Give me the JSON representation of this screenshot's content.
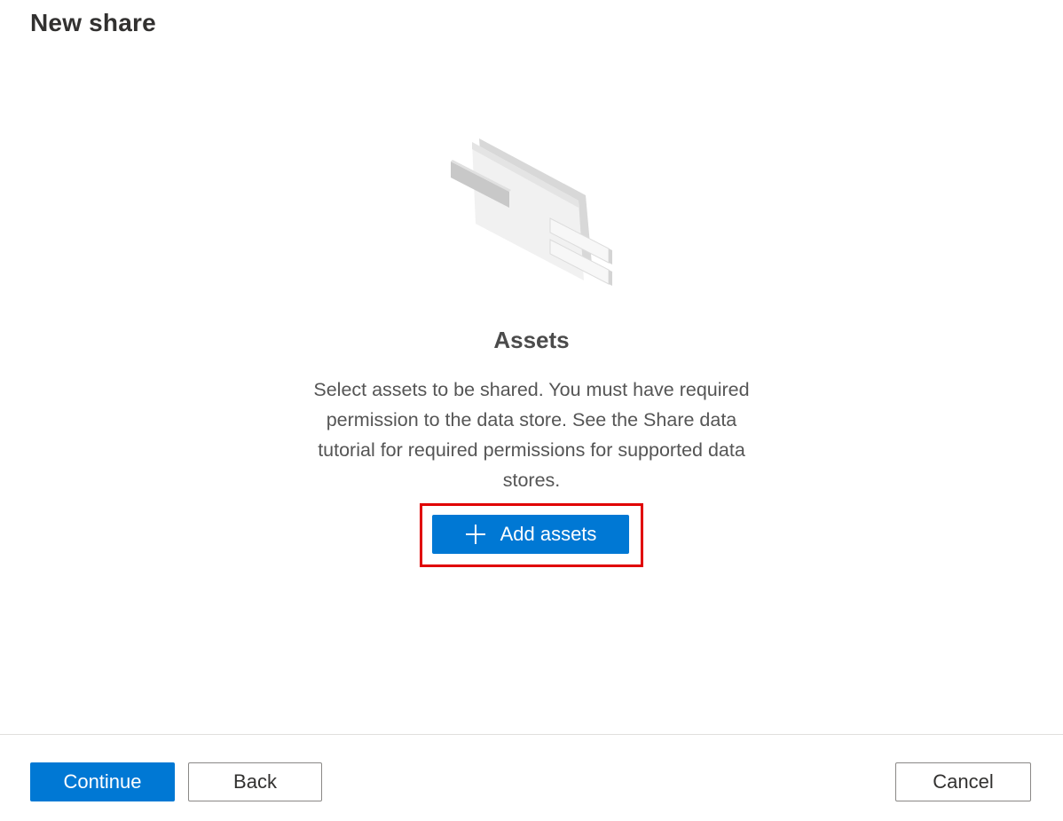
{
  "header": {
    "title": "New share"
  },
  "assets_panel": {
    "illustration_icon": "document-stack-illustration",
    "title": "Assets",
    "description": "Select assets to be shared. You must have required permission to the data store. See the Share data tutorial for required permissions for supported data stores.",
    "add_button_label": "Add assets",
    "add_button_icon": "plus-icon",
    "highlight_color": "#e00000"
  },
  "footer": {
    "continue_label": "Continue",
    "back_label": "Back",
    "cancel_label": "Cancel"
  },
  "colors": {
    "accent": "#0078d4"
  }
}
